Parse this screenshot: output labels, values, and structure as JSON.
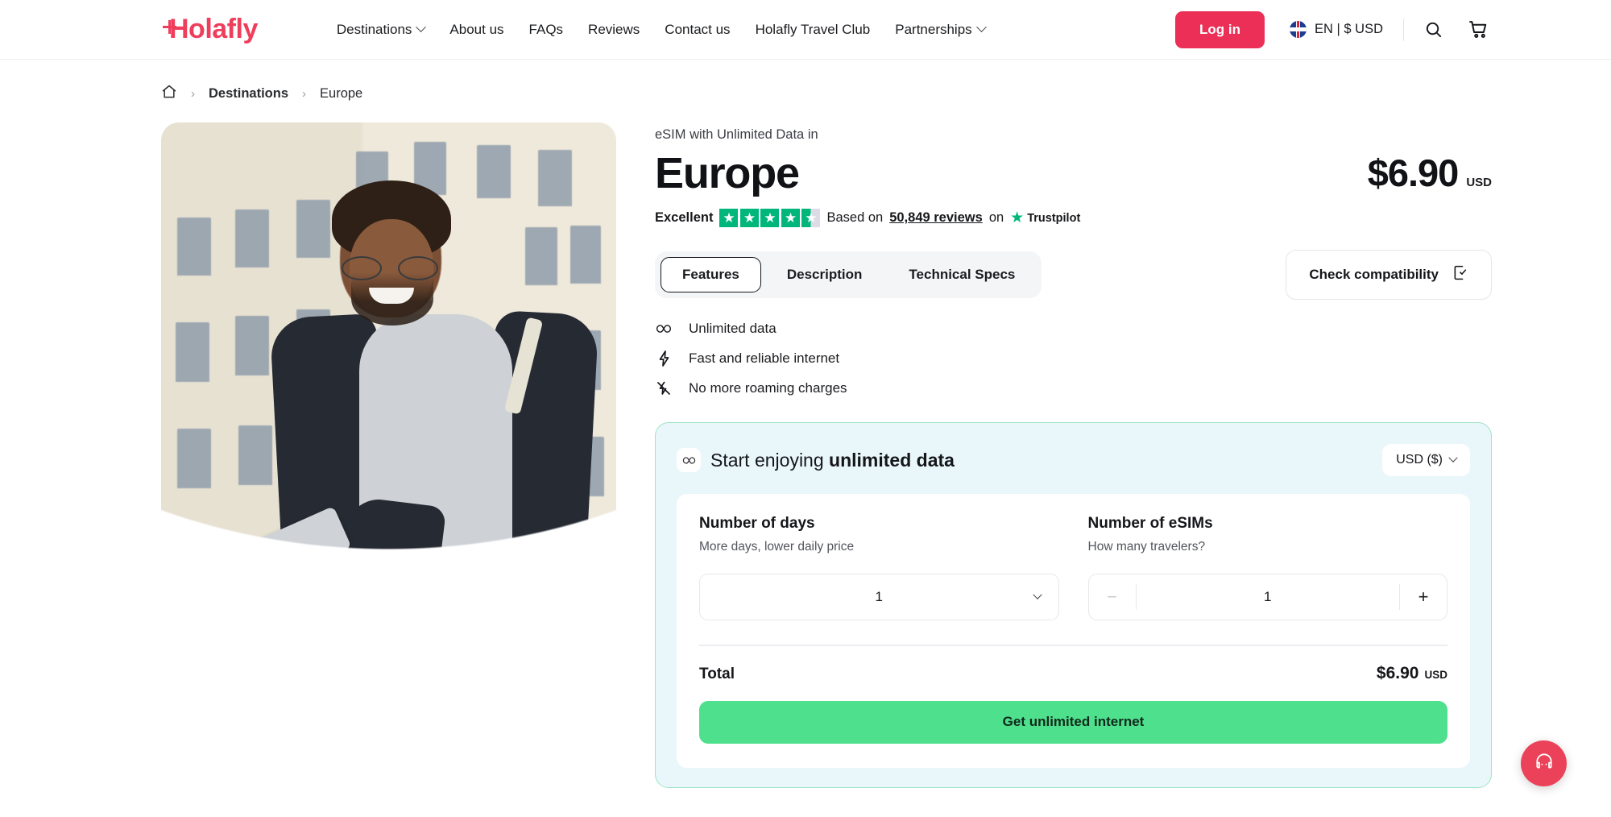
{
  "header": {
    "logo_text": "Holafly",
    "nav": [
      {
        "label": "Destinations",
        "has_chevron": true
      },
      {
        "label": "About us",
        "has_chevron": false
      },
      {
        "label": "FAQs",
        "has_chevron": false
      },
      {
        "label": "Reviews",
        "has_chevron": false
      },
      {
        "label": "Contact us",
        "has_chevron": false
      },
      {
        "label": "Holafly Travel Club",
        "has_chevron": false
      },
      {
        "label": "Partnerships",
        "has_chevron": true
      }
    ],
    "login_label": "Log in",
    "locale_label": "EN | $ USD",
    "flag_icon": "uk-flag-icon",
    "search_icon": "search-icon",
    "cart_icon": "cart-icon",
    "accent_color": "#eb2f57"
  },
  "breadcrumb": {
    "home_icon": "home-icon",
    "separator": "›",
    "items": [
      {
        "label": "Destinations",
        "current": false
      },
      {
        "label": "Europe",
        "current": true
      }
    ]
  },
  "product": {
    "eyebrow": "eSIM with Unlimited Data in",
    "title": "Europe",
    "price": "$6.90",
    "price_currency": "USD",
    "trustpilot": {
      "rating_word": "Excellent",
      "stars_filled": 4.5,
      "stars_total": 5,
      "based_on": "Based on",
      "reviews_link": "50,849 reviews",
      "on_word": "on",
      "brand": "Trustpilot",
      "star_color": "#00b67a"
    },
    "tabs": [
      {
        "label": "Features",
        "active": true
      },
      {
        "label": "Description",
        "active": false
      },
      {
        "label": "Technical Specs",
        "active": false
      }
    ],
    "compatibility_button": {
      "label": "Check compatibility",
      "icon": "phone-check-icon"
    },
    "features": [
      {
        "icon": "infinity-icon",
        "label": "Unlimited data"
      },
      {
        "icon": "lightning-icon",
        "label": "Fast and reliable internet"
      },
      {
        "icon": "no-roaming-icon",
        "label": "No more roaming charges"
      }
    ]
  },
  "buy_card": {
    "badge_icon": "infinity-icon",
    "heading_prefix": "Start enjoying ",
    "heading_strong": "unlimited data",
    "currency_selector": "USD ($)",
    "days": {
      "title": "Number of days",
      "subtitle": "More days, lower daily price",
      "value": "1"
    },
    "esims": {
      "title": "Number of eSIMs",
      "subtitle": "How many travelers?",
      "value": "1",
      "minus_label": "−",
      "plus_label": "+"
    },
    "total_label": "Total",
    "total_price": "$6.90",
    "total_currency": "USD",
    "cta_label": "Get unlimited internet",
    "cta_color": "#4ee08c",
    "card_bg": "#e9f7fb",
    "card_border": "#9fe3c4"
  },
  "chat_fab": {
    "icon": "headset-chat-icon",
    "color": "#eb4259"
  },
  "hero": {
    "alt": "Smiling man with glasses using a smartphone on a European city street"
  }
}
